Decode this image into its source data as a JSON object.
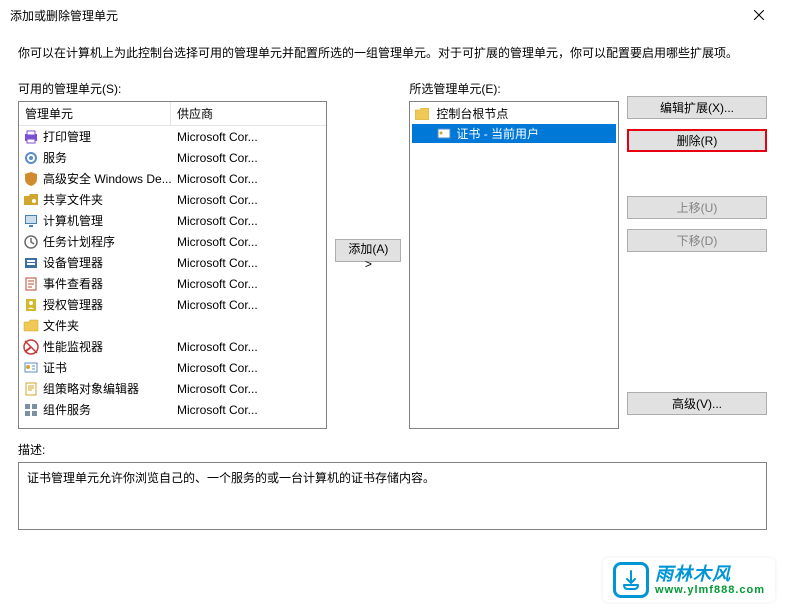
{
  "window": {
    "title": "添加或删除管理单元",
    "intro": "你可以在计算机上为此控制台选择可用的管理单元并配置所选的一组管理单元。对于可扩展的管理单元，你可以配置要启用哪些扩展项。"
  },
  "available": {
    "label": "可用的管理单元(S):",
    "headers": {
      "name": "管理单元",
      "vendor": "供应商"
    },
    "items": [
      {
        "name": "打印管理",
        "vendor": "Microsoft Cor...",
        "icon": "printer"
      },
      {
        "name": "服务",
        "vendor": "Microsoft Cor...",
        "icon": "gear"
      },
      {
        "name": "高级安全 Windows De...",
        "vendor": "Microsoft Cor...",
        "icon": "shield"
      },
      {
        "name": "共享文件夹",
        "vendor": "Microsoft Cor...",
        "icon": "folder-share"
      },
      {
        "name": "计算机管理",
        "vendor": "Microsoft Cor...",
        "icon": "computer"
      },
      {
        "name": "任务计划程序",
        "vendor": "Microsoft Cor...",
        "icon": "clock"
      },
      {
        "name": "设备管理器",
        "vendor": "Microsoft Cor...",
        "icon": "device"
      },
      {
        "name": "事件查看器",
        "vendor": "Microsoft Cor...",
        "icon": "event"
      },
      {
        "name": "授权管理器",
        "vendor": "Microsoft Cor...",
        "icon": "auth"
      },
      {
        "name": "文件夹",
        "vendor": "",
        "icon": "folder"
      },
      {
        "name": "性能监视器",
        "vendor": "Microsoft Cor...",
        "icon": "perf"
      },
      {
        "name": "证书",
        "vendor": "Microsoft Cor...",
        "icon": "cert"
      },
      {
        "name": "组策略对象编辑器",
        "vendor": "Microsoft Cor...",
        "icon": "policy"
      },
      {
        "name": "组件服务",
        "vendor": "Microsoft Cor...",
        "icon": "component"
      }
    ]
  },
  "selected": {
    "label": "所选管理单元(E):",
    "root": "控制台根节点",
    "child": "证书 - 当前用户"
  },
  "buttons": {
    "add": "添加(A) >",
    "edit_ext": "编辑扩展(X)...",
    "remove": "删除(R)",
    "move_up": "上移(U)",
    "move_down": "下移(D)",
    "advanced": "高级(V)..."
  },
  "description": {
    "label": "描述:",
    "text": "证书管理单元允许你浏览自己的、一个服务的或一台计算机的证书存储内容。"
  },
  "watermark": {
    "cn": "雨林木风",
    "url": "www.ylmf888.com"
  },
  "icons": {
    "printer": "#7b4fd1",
    "gear": "#5a8cc7",
    "shield": "#d18b2f",
    "folder-share": "#d1a62f",
    "computer": "#4a7fb5",
    "clock": "#6b6b6b",
    "device": "#3a6ea5",
    "event": "#b54a2f",
    "auth": "#d1b82f",
    "folder": "#f0c854",
    "perf": "#c73a3a",
    "cert": "#5a8cc7",
    "policy": "#d1a62f",
    "component": "#7b8fa5"
  }
}
